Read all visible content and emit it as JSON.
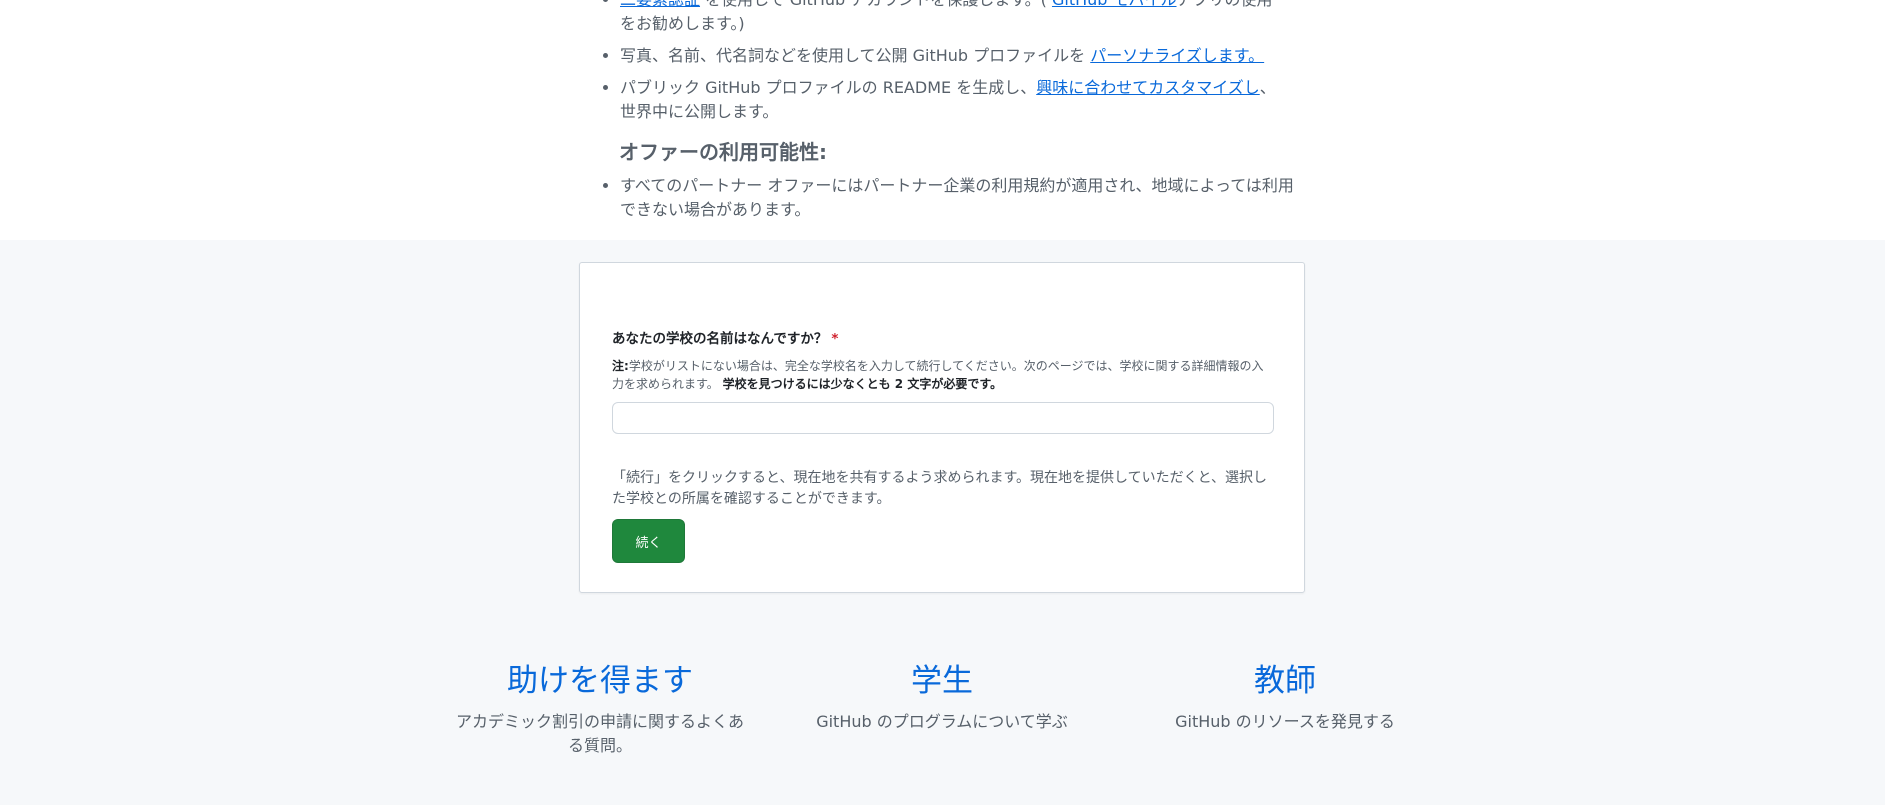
{
  "benefits": {
    "item1": {
      "link": "二要素認証",
      "text_after_link": " を使用して GitHub アカウントを保護します。( ",
      "link2": "GitHub モバイル",
      "text_end": "アプリの使用",
      "continuation": "をお勧めします。)"
    },
    "item2": {
      "text": "写真、名前、代名詞などを使用して公開 GitHub プロファイルを ",
      "link": "パーソナライズします。"
    },
    "item3": {
      "text": "パブリック GitHub プロファイルの README を生成し、",
      "link": "興味に合わせてカスタマイズし",
      "text_end": "、",
      "continuation": "世界中に公開します。"
    }
  },
  "offer": {
    "heading": "オファーの利用可能性:",
    "item": "すべてのパートナー オファーにはパートナー企業の利用規約が適用され、地域によっては利用できない場合があります。"
  },
  "form": {
    "label": "あなたの学校の名前はなんですか？",
    "required_mark": "*",
    "note_label": "注:",
    "note_text": "学校がリストにない場合は、完全な学校名を入力して続行してください。次のページでは、学校に関する詳細情報の入力を求められます。 ",
    "note_bold": "学校を見つけるには少なくとも 2 文字が必要です。",
    "input_value": "",
    "location_text": "「続行」をクリックすると、現在地を共有するよう求められます。現在地を提供していただくと、選択した学校との所属を確認することができます。",
    "continue_label": "続く"
  },
  "footer": {
    "columns": [
      {
        "title": "助けを得ます",
        "desc": "アカデミック割引の申請に関するよくある質問。"
      },
      {
        "title": "学生",
        "desc": "GitHub のプログラムについて学ぶ"
      },
      {
        "title": "教師",
        "desc": "GitHub のリソースを発見する"
      }
    ]
  },
  "colors": {
    "link": "#0969da",
    "button": "#1f883d",
    "required": "#cf222e",
    "text_muted": "#57606a"
  }
}
